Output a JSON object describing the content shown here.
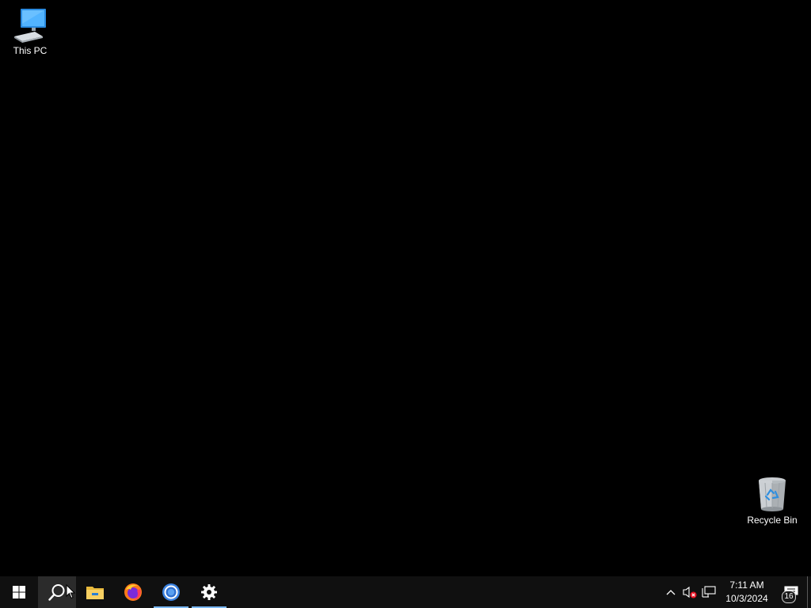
{
  "desktop": {
    "icons": [
      {
        "label": "This PC",
        "icon": "this-pc-icon"
      },
      {
        "label": "Recycle Bin",
        "icon": "recycle-bin-icon"
      }
    ]
  },
  "taskbar": {
    "apps": [
      {
        "name": "Start",
        "icon": "windows-start-icon"
      },
      {
        "name": "Search",
        "icon": "search-icon"
      },
      {
        "name": "File Explorer",
        "icon": "file-explorer-icon"
      },
      {
        "name": "Firefox",
        "icon": "firefox-icon"
      },
      {
        "name": "Chrome",
        "icon": "chrome-icon"
      },
      {
        "name": "Settings",
        "icon": "gear-icon"
      }
    ],
    "tray": {
      "clock_time": "7:11 AM",
      "clock_date": "10/3/2024",
      "notification_count": "16"
    }
  },
  "colors": {
    "desktop_bg": "#000000",
    "taskbar_bg": "#101010",
    "running_indicator": "#7ab8f5"
  }
}
